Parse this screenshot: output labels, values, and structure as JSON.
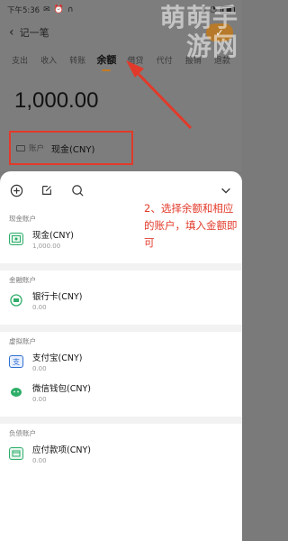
{
  "status_bar": {
    "time": "下午5:36",
    "battery": "69"
  },
  "header": {
    "title": "记一笔",
    "confirm_icon": "check-icon"
  },
  "tabs": [
    {
      "label": "支出",
      "active": false
    },
    {
      "label": "收入",
      "active": false
    },
    {
      "label": "转账",
      "active": false
    },
    {
      "label": "余额",
      "active": true
    },
    {
      "label": "借贷",
      "active": false
    },
    {
      "label": "代付",
      "active": false
    },
    {
      "label": "报销",
      "active": false
    },
    {
      "label": "退款",
      "active": false
    }
  ],
  "amount": "1,000.00",
  "account": {
    "label": "账户",
    "value": "现金(CNY)"
  },
  "watermark": {
    "line1": "萌萌手",
    "line2": "游网"
  },
  "instruction": "2、选择余额和相应的账户，填入金额即可",
  "groups": [
    {
      "title": "现金账户",
      "accounts": [
        {
          "name": "现金(CNY)",
          "balance": "1,000.00",
          "icon": "cash-icon"
        }
      ]
    },
    {
      "title": "金融账户",
      "accounts": [
        {
          "name": "银行卡(CNY)",
          "balance": "0.00",
          "icon": "bank-card-icon"
        }
      ]
    },
    {
      "title": "虚拟账户",
      "accounts": [
        {
          "name": "支付宝(CNY)",
          "balance": "0.00",
          "icon": "alipay-icon"
        },
        {
          "name": "微信钱包(CNY)",
          "balance": "0.00",
          "icon": "wechat-icon"
        }
      ]
    },
    {
      "title": "负债账户",
      "accounts": [
        {
          "name": "应付款项(CNY)",
          "balance": "0.00",
          "icon": "payable-icon"
        }
      ]
    }
  ],
  "colors": {
    "accent": "#c47a20",
    "highlight": "#e23a2a",
    "icon_green": "#2fae6a"
  }
}
